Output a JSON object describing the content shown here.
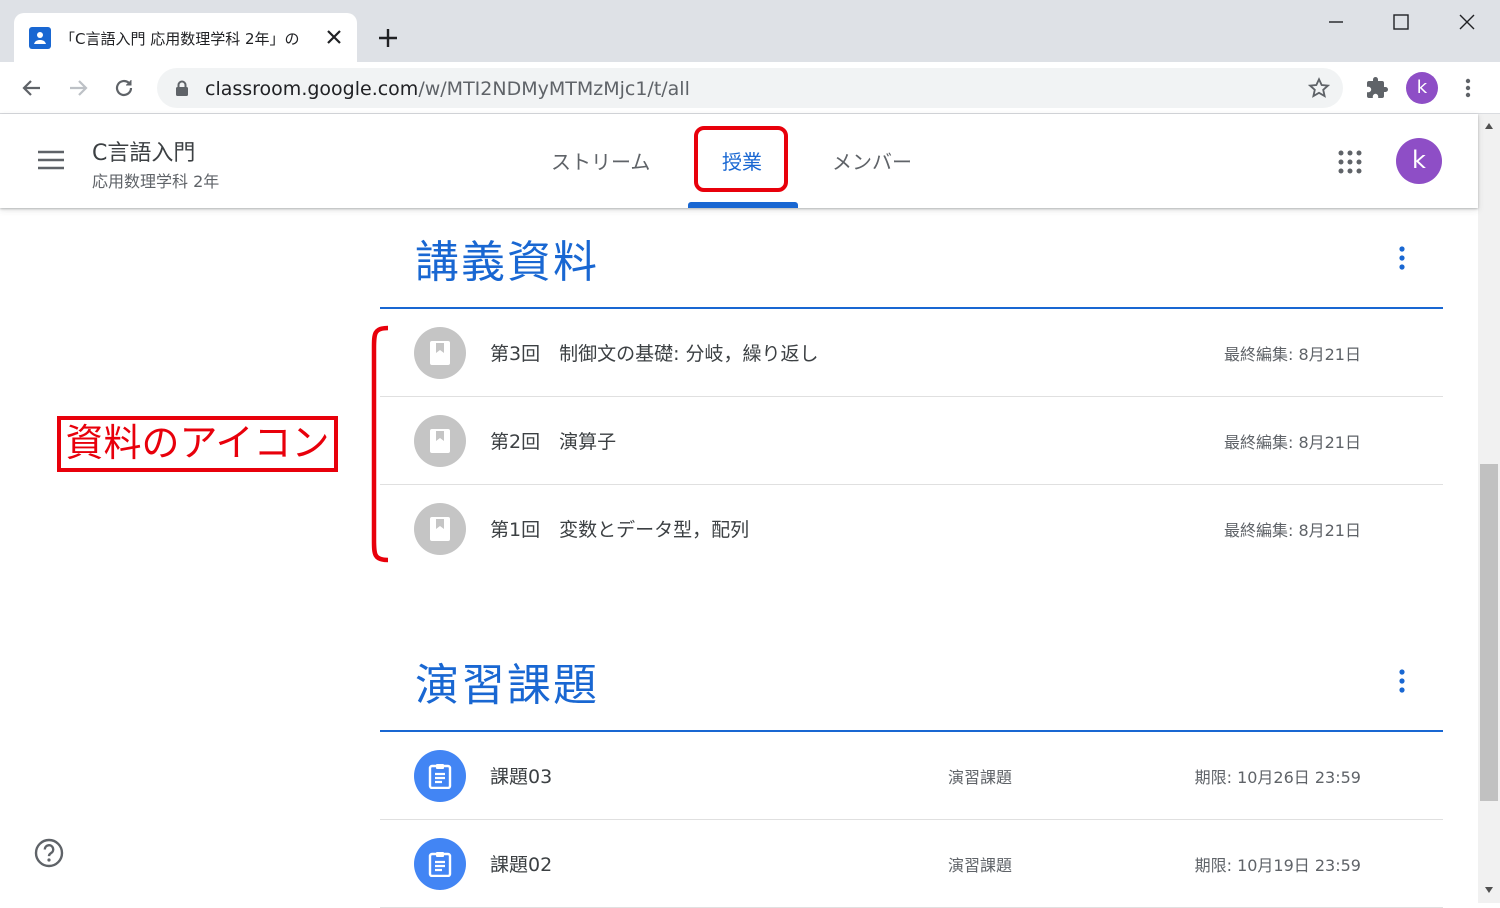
{
  "browser": {
    "tab_title": "「C言語入門 応用数理学科 2年」の",
    "url_host": "classroom.google.com",
    "url_path": "/w/MTI2NDMyMTMzMjc1/t/all",
    "profile_initial": "k"
  },
  "header": {
    "course_title": "C言語入門",
    "course_subtitle": "応用数理学科 2年",
    "tabs": [
      {
        "label": "ストリーム"
      },
      {
        "label": "授業"
      },
      {
        "label": "メンバー"
      }
    ],
    "active_tab": "授業",
    "avatar_initial": "k"
  },
  "sections": [
    {
      "title": "講義資料",
      "items": [
        {
          "icon": "material-icon",
          "name": "第3回　制御文の基礎: 分岐，繰り返し",
          "meta": "最終編集: 8月21日"
        },
        {
          "icon": "material-icon",
          "name": "第2回　演算子",
          "meta": "最終編集: 8月21日"
        },
        {
          "icon": "material-icon",
          "name": "第1回　変数とデータ型，配列",
          "meta": "最終編集: 8月21日"
        }
      ]
    },
    {
      "title": "演習課題",
      "items": [
        {
          "icon": "assignment-icon",
          "name": "課題03",
          "type": "演習課題",
          "meta": "期限: 10月26日 23:59"
        },
        {
          "icon": "assignment-icon",
          "name": "課題02",
          "type": "演習課題",
          "meta": "期限: 10月19日 23:59"
        }
      ]
    }
  ],
  "annotation": {
    "label": "資料のアイコン"
  },
  "colors": {
    "accent": "#1967d2",
    "annotation": "#e8000b",
    "avatar": "#8e4ec6",
    "material_icon_bg": "#c5c5c5",
    "assignment_icon_bg": "#4285f4"
  }
}
